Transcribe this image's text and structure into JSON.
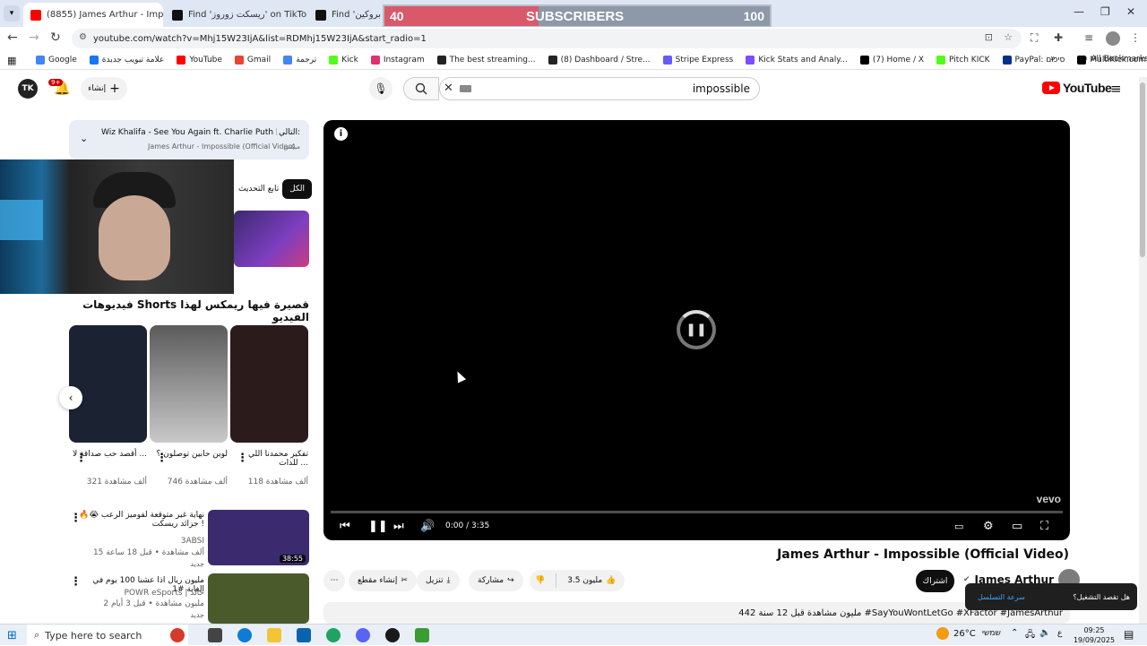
{
  "browser": {
    "tabs": [
      {
        "title": "(8855) James Arthur - Impossib",
        "icon": "youtube-icon",
        "active": true
      },
      {
        "title": "Find 'ريسكت زوروز' on TikTok |",
        "icon": "tiktok-icon",
        "active": false
      },
      {
        "title": "Find 'باسيه بروكين'",
        "icon": "tiktok-icon",
        "active": false
      }
    ],
    "url": "youtube.com/watch?v=Mhj15W23IjA&list=RDMhj15W23IjA&start_radio=1",
    "bookmarks": [
      {
        "label": "Google",
        "color": "#4285f4"
      },
      {
        "label": "علامة تبويب جديدة",
        "color": "#1877f2"
      },
      {
        "label": "YouTube",
        "color": "#ff0000"
      },
      {
        "label": "Gmail",
        "color": "#ea4335"
      },
      {
        "label": "ترجمة",
        "color": "#4285f4"
      },
      {
        "label": "Kick",
        "color": "#53fc18"
      },
      {
        "label": "Instagram",
        "color": "#e1306c"
      },
      {
        "label": "The best streaming...",
        "color": "#222222"
      },
      {
        "label": "(8) Dashboard / Stre...",
        "color": "#222222"
      },
      {
        "label": "Stripe Express",
        "color": "#635bff"
      },
      {
        "label": "Kick Stats and Analy...",
        "color": "#7b4dff"
      },
      {
        "label": "(7) Home / X",
        "color": "#000000"
      },
      {
        "label": "Pitch KICK",
        "color": "#53fc18"
      },
      {
        "label": "PayPal: סיכום",
        "color": "#003087"
      },
      {
        "label": "MultiKick.com: Wat...",
        "color": "#000000"
      }
    ],
    "all_bookmarks": "All Bookmarks"
  },
  "overlay": {
    "subs_current": "40",
    "subs_label": "SUBSCRIBERS",
    "subs_goal": "100",
    "progress_fraction": 0.4
  },
  "youtube": {
    "logo": "YouTube",
    "search_value": "impossible",
    "create_label": "إنشاء",
    "avatar_text": "TK",
    "notif_count": "9+",
    "playlist": {
      "next_label": "التالي:",
      "next_title": "Wiz Khalifa - See You Again ft. Charlie Puth [O...",
      "mix_label": "ميكس",
      "channel_line": "James Arthur - Impossible (Official Video)"
    },
    "chips": {
      "all": "الكل",
      "from_source": "من تابع التحديث"
    },
    "shorts_title": "فيديوهات Shorts قصيرة فيها ريمكس لهذا الفيديو",
    "shorts": [
      {
        "title": "أقصد حب صداقة لا ...",
        "views": "321 ألف مشاهدة",
        "color": "#1b2333"
      },
      {
        "title": "لوين حابين توصلون ؟",
        "views": "746 ألف مشاهدة",
        "color": "#5b5b5b"
      },
      {
        "title": "تفكير محمدنا اللي للذات ...",
        "views": "118 ألف مشاهدة",
        "color": "#2b1b1b"
      }
    ],
    "videos": [
      {
        "title": "نهاية غير متوقعة لفوميز الرعب 😭🔥 ! جزائد ريسكت",
        "channel": "3ABSI",
        "meta": "15 ألف مشاهدة • قبل 18 ساعة",
        "badge": "جديد",
        "duration": "38:55",
        "color": "#3b2a6e"
      },
      {
        "title": "مليون ريال اذا عشنا 100 يوم في الغابة #1",
        "channel": "POWR eSports | خالد",
        "meta": "2 مليون مشاهدة • قبل 3 أيام",
        "badge": "جديد",
        "duration": "",
        "color": "#4a5a2a"
      }
    ]
  },
  "player": {
    "time": "0:00 / 3:35",
    "watermark": "vevo",
    "info_icon": "info-icon"
  },
  "video": {
    "title": "James Arthur - Impossible (Official Video)",
    "channel": "James Arthur",
    "subscribe": "اشتراك",
    "likes": "3.5 مليون",
    "share": "مشاركة",
    "download": "تنزيل",
    "clip": "إنشاء مقطع",
    "description": "442 مليون مشاهدة قبل 12 سنة #SayYouWontLetGo #XFactor #JamesArthur"
  },
  "toast": {
    "question": "هل تقصد التشغيل؟",
    "link": "سرعة التسلسل"
  },
  "taskbar": {
    "search_placeholder": "Type here to search",
    "weather": "26°C",
    "weather_label": "שמשי",
    "time": "09:25",
    "date": "19/09/2025",
    "lang": "ع"
  },
  "colors": {
    "brand": "#ff0000",
    "accent": "#3ea6ff",
    "overlay_red": "#d9596a"
  }
}
